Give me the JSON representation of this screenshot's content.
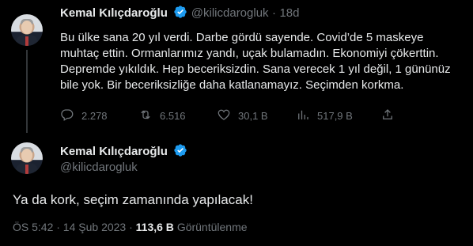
{
  "tweet1": {
    "name": "Kemal Kılıçdaroğlu",
    "handle": "@kilicdarogluk",
    "separator": "·",
    "time": "18d",
    "text": "Bu ülke sana 20 yıl verdi. Darbe gördü sayende. Covid’de 5 maskeye muhtaç ettin. Ormanlarımız yandı, uçak bulamadın. Ekonomiyi çökerttin. Depremde yıkıldık. Hep beceriksizdin. Sana verecek 1 yıl değil, 1 gününüz bile yok. Bir beceriksizliğe daha katlanamayız. Seçimden korkma.",
    "replies": "2.278",
    "retweets": "6.516",
    "likes": "30,1 B",
    "views": "517,9 B"
  },
  "tweet2": {
    "name": "Kemal Kılıçdaroğlu",
    "handle": "@kilicdarogluk",
    "text": "Ya da kork, seçim zamanında yapılacak!",
    "time": "ÖS 5:42 · 14 Şub 2023 ·",
    "views_count": "113,6 B",
    "views_label": "Görüntülenme"
  },
  "colors": {
    "verified": "#1d9bf0",
    "background": "#000000",
    "muted": "#71767b"
  }
}
